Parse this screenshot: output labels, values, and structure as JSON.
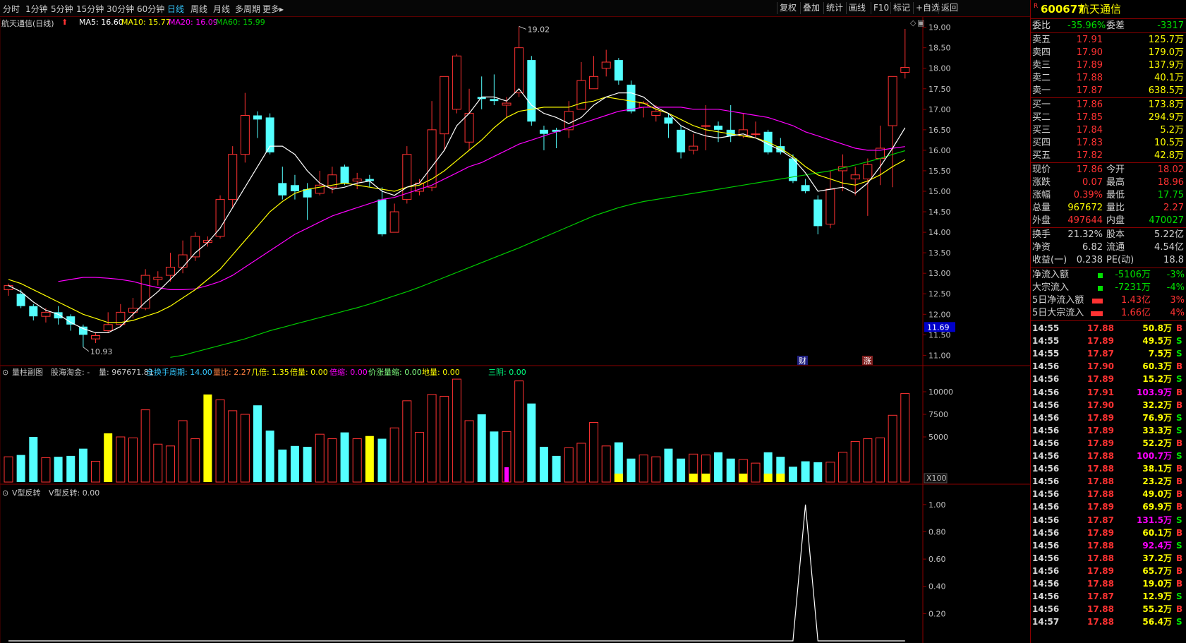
{
  "toolbar": {
    "periods": [
      "分时",
      "1分钟",
      "5分钟",
      "15分钟",
      "30分钟",
      "60分钟",
      "日线",
      "周线",
      "月线",
      "多周期",
      "更多▸"
    ],
    "active_period": "日线",
    "right_buttons": [
      "复权",
      "叠加",
      "统计",
      "画线",
      "F10",
      "标记",
      "+自选",
      "返回"
    ]
  },
  "main": {
    "title": "航天通信(日线)",
    "ma5": "MA5: 16.60",
    "ma10": "MA10: 15.77",
    "ma20": "MA20: 16.09",
    "ma60": "MA60: 15.99",
    "high_mark": "19.02",
    "low_mark": "10.93",
    "current_price_tag": "11.69",
    "badge_cai": "财",
    "badge_zhang": "涨",
    "y_labels": [
      "19.00",
      "18.50",
      "18.00",
      "17.50",
      "17.00",
      "16.50",
      "16.00",
      "15.50",
      "15.00",
      "14.50",
      "14.00",
      "13.50",
      "13.00",
      "12.50",
      "12.00",
      "11.50",
      "11.00"
    ],
    "colors": {
      "up": "#ff3232",
      "down": "#54ffff",
      "ma5": "#ffffff",
      "ma10": "#ffff00",
      "ma20": "#ff00ff",
      "ma60": "#00cc00"
    }
  },
  "volume": {
    "title": "量柱副图",
    "items": [
      "股海淘金: -",
      "量: 967671.81",
      "全换手周期: 14.00",
      "量比: 2.27",
      "几倍: 1.35",
      "倍量: 0.00",
      "倍缩: 0.00",
      "价涨量缩: 0.00",
      "地量: 0.00",
      "三阴: 0.00"
    ],
    "y_labels": [
      "10000",
      "7500",
      "5000"
    ],
    "unit": "X100"
  },
  "indicator": {
    "title": "V型反转",
    "value": "V型反转: 0.00",
    "y_labels": [
      "1.00",
      "0.80",
      "0.60",
      "0.40",
      "0.20"
    ]
  },
  "quote": {
    "code": "600677",
    "name": "航天通信",
    "weibi_label": "委比",
    "weibi": "-35.96%",
    "weicha_label": "委差",
    "weicha": "-3317",
    "asks": [
      {
        "label": "卖五",
        "price": "17.91",
        "vol": "125.7万"
      },
      {
        "label": "卖四",
        "price": "17.90",
        "vol": "179.0万"
      },
      {
        "label": "卖三",
        "price": "17.89",
        "vol": "137.9万"
      },
      {
        "label": "卖二",
        "price": "17.88",
        "vol": "40.1万"
      },
      {
        "label": "卖一",
        "price": "17.87",
        "vol": "638.5万"
      }
    ],
    "bids": [
      {
        "label": "买一",
        "price": "17.86",
        "vol": "173.8万"
      },
      {
        "label": "买二",
        "price": "17.85",
        "vol": "294.9万"
      },
      {
        "label": "买三",
        "price": "17.84",
        "vol": "5.2万"
      },
      {
        "label": "买四",
        "price": "17.83",
        "vol": "10.5万"
      },
      {
        "label": "买五",
        "price": "17.82",
        "vol": "42.8万"
      }
    ],
    "stats": [
      {
        "l1": "现价",
        "v1": "17.86",
        "l2": "今开",
        "v2": "18.02",
        "c1": "#ff3232",
        "c2": "#ff3232"
      },
      {
        "l1": "涨跌",
        "v1": "0.07",
        "l2": "最高",
        "v2": "18.96",
        "c1": "#ff3232",
        "c2": "#ff3232"
      },
      {
        "l1": "涨幅",
        "v1": "0.39%",
        "l2": "最低",
        "v2": "17.75",
        "c1": "#ff3232",
        "c2": "#00e000"
      },
      {
        "l1": "总量",
        "v1": "967672",
        "l2": "量比",
        "v2": "2.27",
        "c1": "#ffff00",
        "c2": "#ff3232"
      },
      {
        "l1": "外盘",
        "v1": "497644",
        "l2": "内盘",
        "v2": "470027",
        "c1": "#ff3232",
        "c2": "#00e000"
      }
    ],
    "stats2": [
      {
        "l1": "换手",
        "v1": "21.32%",
        "l2": "股本",
        "v2": "5.22亿"
      },
      {
        "l1": "净资",
        "v1": "6.82",
        "l2": "流通",
        "v2": "4.54亿"
      },
      {
        "l1": "收益(一)",
        "v1": "0.238",
        "l2": "PE(动)",
        "v2": "18.8"
      }
    ],
    "flows": [
      {
        "label": "净流入额",
        "value": "-5106万",
        "pct": "-3%",
        "color": "#00e000",
        "bar": 0.2
      },
      {
        "label": "大宗流入",
        "value": "-7231万",
        "pct": "-4%",
        "color": "#00e000",
        "bar": 0.2
      },
      {
        "label": "5日净流入额",
        "value": "1.43亿",
        "pct": "3%",
        "color": "#ff3232",
        "bar": 0.7
      },
      {
        "label": "5日大宗流入",
        "value": "1.66亿",
        "pct": "4%",
        "color": "#ff3232",
        "bar": 0.8
      }
    ],
    "ticks": [
      [
        "14:55",
        "17.88",
        "50.8万",
        "B"
      ],
      [
        "14:55",
        "17.89",
        "49.5万",
        "S"
      ],
      [
        "14:55",
        "17.87",
        "7.5万",
        "S"
      ],
      [
        "14:56",
        "17.90",
        "60.3万",
        "B"
      ],
      [
        "14:56",
        "17.89",
        "15.2万",
        "S"
      ],
      [
        "14:56",
        "17.91",
        "103.9万",
        "B"
      ],
      [
        "14:56",
        "17.90",
        "32.2万",
        "B"
      ],
      [
        "14:56",
        "17.89",
        "76.9万",
        "S"
      ],
      [
        "14:56",
        "17.89",
        "33.3万",
        "S"
      ],
      [
        "14:56",
        "17.89",
        "52.2万",
        "B"
      ],
      [
        "14:56",
        "17.88",
        "100.7万",
        "S"
      ],
      [
        "14:56",
        "17.88",
        "38.1万",
        "B"
      ],
      [
        "14:56",
        "17.88",
        "23.2万",
        "B"
      ],
      [
        "14:56",
        "17.88",
        "49.0万",
        "B"
      ],
      [
        "14:56",
        "17.89",
        "69.9万",
        "B"
      ],
      [
        "14:56",
        "17.87",
        "131.5万",
        "S"
      ],
      [
        "14:56",
        "17.89",
        "60.1万",
        "B"
      ],
      [
        "14:56",
        "17.88",
        "92.4万",
        "S"
      ],
      [
        "14:56",
        "17.88",
        "37.2万",
        "B"
      ],
      [
        "14:56",
        "17.89",
        "65.7万",
        "B"
      ],
      [
        "14:56",
        "17.88",
        "19.0万",
        "B"
      ],
      [
        "14:56",
        "17.87",
        "12.9万",
        "S"
      ],
      [
        "14:56",
        "17.88",
        "55.2万",
        "B"
      ],
      [
        "14:57",
        "17.88",
        "56.4万",
        "S"
      ]
    ]
  },
  "chart_data": {
    "type": "candlestick",
    "ylim": [
      10.8,
      19.2
    ],
    "candles": [
      [
        12.6,
        12.7,
        12.45,
        12.75
      ],
      [
        12.5,
        12.2,
        12.15,
        12.6
      ],
      [
        12.2,
        11.95,
        11.85,
        12.25
      ],
      [
        11.95,
        12.05,
        11.8,
        12.15
      ],
      [
        12.05,
        11.9,
        11.75,
        12.2
      ],
      [
        11.95,
        11.75,
        11.6,
        12.0
      ],
      [
        11.7,
        11.5,
        11.2,
        11.75
      ],
      [
        11.4,
        11.48,
        11.3,
        11.55
      ],
      [
        11.6,
        11.75,
        11.55,
        12.05
      ],
      [
        11.75,
        12.05,
        11.7,
        12.25
      ],
      [
        12.05,
        12.15,
        11.9,
        12.4
      ],
      [
        12.15,
        12.95,
        12.1,
        13.1
      ],
      [
        12.85,
        12.9,
        12.7,
        13.05
      ],
      [
        12.95,
        13.15,
        12.8,
        13.5
      ],
      [
        13.15,
        13.45,
        13.0,
        13.8
      ],
      [
        13.4,
        13.9,
        13.3,
        14.0
      ],
      [
        13.75,
        13.8,
        13.65,
        13.9
      ],
      [
        13.9,
        14.8,
        13.85,
        14.9
      ],
      [
        14.8,
        15.9,
        14.6,
        16.1
      ],
      [
        15.9,
        16.85,
        15.7,
        17.4
      ],
      [
        16.85,
        16.75,
        16.3,
        16.95
      ],
      [
        16.8,
        15.95,
        15.9,
        16.9
      ],
      [
        15.2,
        14.9,
        14.8,
        15.6
      ],
      [
        15.15,
        15.0,
        14.8,
        15.4
      ],
      [
        15.05,
        14.85,
        14.3,
        15.2
      ],
      [
        14.95,
        15.15,
        14.9,
        15.5
      ],
      [
        15.1,
        15.4,
        14.95,
        15.6
      ],
      [
        15.6,
        15.2,
        15.15,
        15.65
      ],
      [
        15.25,
        15.3,
        15.05,
        15.45
      ],
      [
        15.3,
        15.25,
        15.1,
        15.4
      ],
      [
        14.8,
        13.95,
        13.9,
        15.1
      ],
      [
        14.0,
        14.5,
        14.0,
        14.7
      ],
      [
        14.8,
        15.9,
        14.7,
        16.1
      ],
      [
        15.0,
        15.2,
        14.9,
        15.3
      ],
      [
        15.1,
        16.5,
        15.0,
        17.2
      ],
      [
        16.4,
        17.8,
        16.0,
        17.7
      ],
      [
        17.0,
        18.3,
        16.9,
        18.35
      ],
      [
        16.2,
        16.9,
        16.0,
        17.5
      ],
      [
        17.3,
        17.25,
        17.0,
        17.8
      ],
      [
        17.25,
        17.2,
        17.1,
        17.85
      ],
      [
        17.1,
        17.15,
        16.8,
        17.3
      ],
      [
        17.4,
        18.5,
        17.3,
        19.02
      ],
      [
        18.2,
        16.7,
        16.6,
        18.3
      ],
      [
        16.5,
        16.4,
        16.0,
        16.6
      ],
      [
        16.5,
        16.45,
        16.05,
        16.55
      ],
      [
        16.5,
        16.95,
        16.3,
        17.2
      ],
      [
        17.0,
        17.7,
        17.0,
        18.15
      ],
      [
        17.5,
        17.8,
        17.5,
        18.3
      ],
      [
        18.0,
        18.15,
        17.8,
        18.45
      ],
      [
        18.2,
        17.7,
        17.6,
        18.25
      ],
      [
        17.6,
        16.95,
        16.9,
        17.7
      ],
      [
        17.05,
        17.15,
        16.8,
        17.2
      ],
      [
        16.85,
        16.95,
        16.7,
        17.1
      ],
      [
        16.8,
        16.65,
        16.3,
        16.9
      ],
      [
        16.5,
        15.95,
        15.8,
        16.6
      ],
      [
        16.0,
        16.1,
        15.9,
        16.4
      ],
      [
        16.6,
        16.6,
        16.0,
        17.1
      ],
      [
        16.6,
        16.5,
        16.2,
        16.7
      ],
      [
        16.5,
        16.35,
        16.2,
        17.1
      ],
      [
        16.35,
        16.5,
        16.3,
        16.9
      ],
      [
        16.4,
        16.4,
        16.3,
        16.7
      ],
      [
        16.45,
        15.95,
        15.9,
        16.5
      ],
      [
        16.1,
        15.95,
        15.9,
        16.3
      ],
      [
        15.8,
        15.25,
        15.2,
        15.9
      ],
      [
        15.15,
        15.0,
        14.95,
        15.3
      ],
      [
        14.8,
        14.15,
        13.95,
        14.9
      ],
      [
        14.2,
        15.05,
        14.1,
        15.5
      ],
      [
        15.5,
        15.6,
        15.0,
        15.9
      ],
      [
        15.3,
        15.4,
        14.9,
        15.6
      ],
      [
        15.3,
        15.65,
        14.4,
        15.8
      ],
      [
        15.8,
        16.05,
        15.15,
        16.6
      ],
      [
        16.6,
        17.8,
        15.1,
        17.8
      ],
      [
        17.9,
        18.02,
        17.75,
        18.96
      ]
    ],
    "ma5": [
      12.7,
      12.55,
      12.3,
      12.1,
      12.0,
      11.8,
      11.65,
      11.55,
      11.55,
      11.7,
      12.0,
      12.3,
      12.55,
      12.85,
      13.15,
      13.5,
      13.75,
      14.1,
      14.6,
      15.1,
      15.6,
      16.1,
      16.1,
      15.9,
      15.5,
      15.2,
      15.05,
      15.1,
      15.2,
      15.25,
      15.0,
      14.9,
      15.1,
      15.2,
      15.6,
      16.0,
      16.6,
      16.9,
      17.3,
      17.3,
      17.2,
      17.5,
      17.1,
      16.9,
      16.8,
      16.65,
      16.8,
      17.1,
      17.3,
      17.4,
      17.4,
      17.3,
      17.05,
      16.9,
      16.6,
      16.45,
      16.35,
      16.3,
      16.35,
      16.4,
      16.3,
      16.15,
      16.0,
      15.8,
      15.45,
      15.0,
      15.05,
      15.1,
      14.95,
      15.2,
      15.6,
      16.05,
      16.55
    ],
    "ma10": [
      12.85,
      12.75,
      12.6,
      12.45,
      12.3,
      12.15,
      12.0,
      11.9,
      11.8,
      11.8,
      11.85,
      11.95,
      12.05,
      12.2,
      12.4,
      12.6,
      12.85,
      13.1,
      13.45,
      13.8,
      14.15,
      14.5,
      14.75,
      14.95,
      15.05,
      15.1,
      15.15,
      15.2,
      15.15,
      15.1,
      15.05,
      15.0,
      15.1,
      15.15,
      15.3,
      15.5,
      15.75,
      16.0,
      16.25,
      16.55,
      16.8,
      16.95,
      17.0,
      17.05,
      17.05,
      17.05,
      17.15,
      17.2,
      17.3,
      17.25,
      17.2,
      17.15,
      17.0,
      16.9,
      16.75,
      16.6,
      16.5,
      16.45,
      16.4,
      16.35,
      16.3,
      16.2,
      16.05,
      15.85,
      15.6,
      15.4,
      15.3,
      15.2,
      15.15,
      15.25,
      15.4,
      15.6,
      15.77
    ],
    "ma20": [
      null,
      null,
      null,
      null,
      12.8,
      12.85,
      12.9,
      12.9,
      12.88,
      12.85,
      12.8,
      12.72,
      12.65,
      12.6,
      12.6,
      12.62,
      12.7,
      12.8,
      12.95,
      13.15,
      13.35,
      13.55,
      13.75,
      13.95,
      14.1,
      14.25,
      14.4,
      14.5,
      14.6,
      14.7,
      14.8,
      14.85,
      14.95,
      15.05,
      15.15,
      15.3,
      15.45,
      15.6,
      15.7,
      15.85,
      16.0,
      16.15,
      16.25,
      16.35,
      16.45,
      16.55,
      16.65,
      16.75,
      16.85,
      16.95,
      17.0,
      17.05,
      17.05,
      17.05,
      17.05,
      17.0,
      17.0,
      17.0,
      16.95,
      16.9,
      16.85,
      16.8,
      16.7,
      16.6,
      16.45,
      16.35,
      16.25,
      16.15,
      16.05,
      16.0,
      16.0,
      16.05,
      16.09
    ],
    "ma60": [
      null,
      null,
      null,
      null,
      null,
      null,
      null,
      null,
      null,
      null,
      null,
      null,
      null,
      10.95,
      11.0,
      11.08,
      11.16,
      11.24,
      11.32,
      11.4,
      11.5,
      11.6,
      11.68,
      11.76,
      11.84,
      11.92,
      12.0,
      12.08,
      12.16,
      12.25,
      12.35,
      12.45,
      12.55,
      12.66,
      12.78,
      12.9,
      13.02,
      13.14,
      13.26,
      13.38,
      13.5,
      13.62,
      13.75,
      13.88,
      14.01,
      14.14,
      14.27,
      14.4,
      14.5,
      14.6,
      14.68,
      14.75,
      14.8,
      14.85,
      14.9,
      14.95,
      15.0,
      15.05,
      15.1,
      15.15,
      15.2,
      15.25,
      15.3,
      15.35,
      15.4,
      15.45,
      15.5,
      15.57,
      15.64,
      15.72,
      15.8,
      15.9,
      15.99
    ],
    "volumes": [
      2800,
      3000,
      5000,
      2700,
      2800,
      2900,
      3700,
      2300,
      5400,
      5000,
      4900,
      8000,
      4200,
      4000,
      6800,
      4800,
      9700,
      9100,
      7900,
      7500,
      8500,
      5700,
      3600,
      4000,
      3900,
      5300,
      4800,
      5500,
      4800,
      5100,
      4800,
      6000,
      9000,
      5500,
      9700,
      9500,
      11400,
      6800,
      7500,
      5600,
      5600,
      11200,
      8700,
      3900,
      2900,
      3800,
      4300,
      6600,
      4000,
      4400,
      2600,
      3000,
      2800,
      3700,
      2600,
      3100,
      3000,
      3300,
      2600,
      2500,
      2100,
      3300,
      2800,
      1700,
      2300,
      2200,
      2200,
      3300,
      4500,
      4800,
      4900,
      7400,
      9800
    ],
    "v_reversal": [
      0,
      0,
      0,
      0,
      0,
      0,
      0,
      0,
      0,
      0,
      0,
      0,
      0,
      0,
      0,
      0,
      0,
      0,
      0,
      0,
      0,
      0,
      0,
      0,
      0,
      0,
      0,
      0,
      0,
      0,
      0,
      0,
      0,
      0,
      0,
      0,
      0,
      0,
      0,
      0,
      0,
      0,
      0,
      0,
      0,
      0,
      0,
      0,
      0,
      0,
      0,
      0,
      0,
      0,
      0,
      0,
      0,
      0,
      0,
      0,
      0,
      0,
      0,
      0,
      1,
      0,
      0,
      0,
      0,
      0,
      0,
      0,
      0
    ]
  }
}
